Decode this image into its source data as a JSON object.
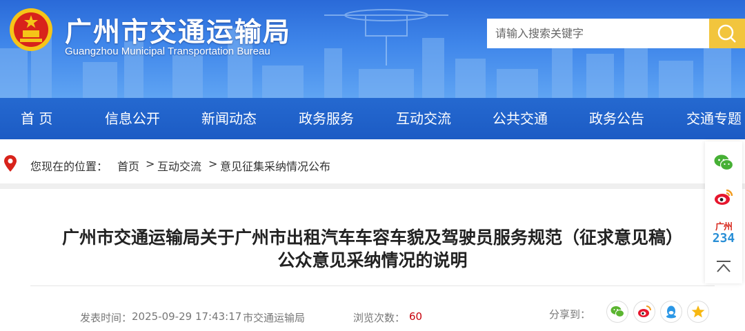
{
  "header": {
    "title": "广州市交通运输局",
    "subtitle": "Guangzhou Municipal Transportation Bureau",
    "search_placeholder": "请输入搜索关键字",
    "colors": {
      "banner": "#3f86ea",
      "nav": "#1c5bc4",
      "search_button": "#f2c53d"
    }
  },
  "nav": {
    "items": [
      "首 页",
      "信息公开",
      "新闻动态",
      "政务服务",
      "互动交流",
      "公共交通",
      "政务公告",
      "交通专题"
    ]
  },
  "breadcrumb": {
    "prefix": "您现在的位置：",
    "items": [
      "首页",
      "互动交流",
      "意见征集采纳情况公布"
    ],
    "separator": ">"
  },
  "article": {
    "title_line1": "广州市交通运输局关于广州市出租汽车车容车貌及驾驶员服务规范（征求意见稿）",
    "title_line2": "公众意见采纳情况的说明",
    "publish_label": "发表时间：",
    "publish_time": "2025-09-29 17:43:17",
    "source": "市交通运输局",
    "views_label": "浏览次数：",
    "views": "60",
    "share_label": "分享到："
  },
  "share_icons": [
    "wechat-icon",
    "weibo-icon",
    "qq-icon",
    "qzone-icon"
  ],
  "float_bar": {
    "badge_top": "广州",
    "badge_num": "234",
    "icons": [
      "wechat-icon",
      "weibo-icon",
      "guangzhou-234-badge",
      "back-to-top-icon"
    ]
  }
}
